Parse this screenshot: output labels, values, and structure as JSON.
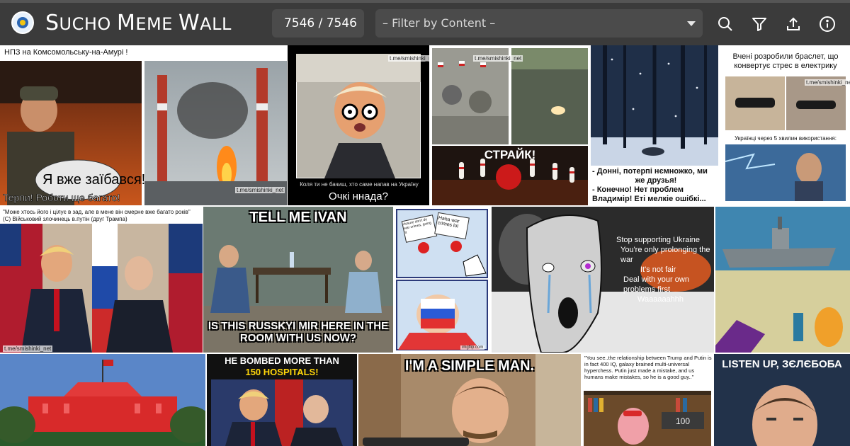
{
  "app": {
    "title_parts": [
      "S",
      "UCHO ",
      "M",
      "EME ",
      "W",
      "ALL"
    ],
    "counter": "7546 / 7546",
    "filter_placeholder": "– Filter by Content –",
    "colors": {
      "bar": "#3b3b3b",
      "field": "#4b4b4b",
      "text": "#ffffff"
    },
    "icons": [
      "search-icon",
      "filter-icon",
      "upload-icon",
      "info-icon"
    ]
  },
  "memes": {
    "m1": {
      "caption": "НПЗ на Комсомольську-на-Амурі !",
      "bubble": "Я вже заїбався!",
      "bottom": "Терпи! Роботи ще багато!",
      "wm": "t.me/smishinki_net"
    },
    "m2": {
      "caption": "Коля ти не бачиш, хто саме напав на Україну",
      "title": "Очкі ннада?",
      "wm": "t.me/smishinki_net"
    },
    "m3": {
      "banner": "СТРАЙК!",
      "wm": "t.me/smishinki_net"
    },
    "m4": {
      "line1": "- Донні, потерпі нємножко, ми",
      "line2": "же друзья!",
      "line3": "- Конечно! Нет проблем",
      "line4": "Владимір! Еті мелкіе ошібкі..."
    },
    "m5": {
      "top": "Вчені розробили браслет, що конвертує стрес в електрику",
      "mid": "Українці через 5 хвилин використання:",
      "wm": "t.me/smishinki_net"
    },
    "m6": {
      "top1": "\"Може хтось його і цілує в зад, але в мене він смерне вже багато років\"",
      "top2": "(С) Військовий злочинець в.путін (друг Трампа)",
      "wm": "t.me/smishinki_net"
    },
    "m7": {
      "top": "TELL ME IVAN",
      "bottom": "IS THIS RUSSKYI MIR HERE IN THE ROOM WITH US NOW?"
    },
    "m8": {
      "btn1": "Assure don't do war crimes, going it",
      "btn2": "Haha war crimes lol",
      "wm": "imgflip.com"
    },
    "m9": {
      "l1": "Stop supporting Ukraine",
      "l2": "You're only prolonging the war",
      "l3": "It's not fair",
      "l4": "Deal with your own problems first",
      "l5": "Waaaaaahhh"
    },
    "m11": {
      "title1": "HE BOMBED MORE THAN",
      "title2": "150 HOSPITALS!"
    },
    "m12": {
      "title": "I'M A SIMPLE MAN."
    },
    "m13": {
      "quote": "\"You see..the relationship between Trump and Putin is in fact 400 IQ, galaxy brained multi-universal hyperchess. Putin just made a mistake, and us humans make mistakes, so he is a good guy..\"",
      "tag": "100"
    },
    "m14": {
      "title": "LISTEN UP, ЗЄЛЄБОБА"
    }
  }
}
